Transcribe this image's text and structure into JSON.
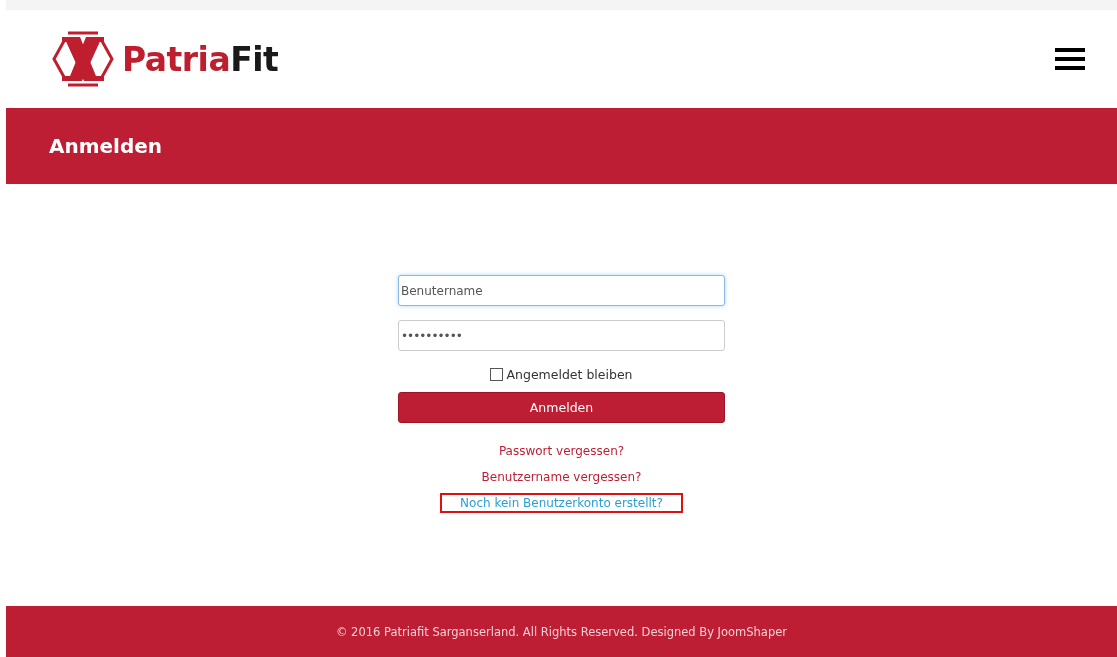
{
  "header": {
    "logo": {
      "primary": "Patria",
      "secondary": "Fit"
    }
  },
  "page_title": "Anmelden",
  "form": {
    "username": {
      "value": "Benutername",
      "focused": true
    },
    "password": {
      "value": "••••••••••",
      "focused": false
    },
    "remember": {
      "label": "Angemeldet bleiben",
      "checked": false
    },
    "submit": "Anmelden",
    "links": [
      {
        "label": "Passwort vergessen?",
        "kind": "accent",
        "highlighted": false
      },
      {
        "label": "Benutzername vergessen?",
        "kind": "accent",
        "highlighted": false
      },
      {
        "label": "Noch kein Benutzerkonto erstellt?",
        "kind": "info",
        "highlighted": true
      }
    ]
  },
  "footer": "© 2016 Patriafit Sarganserland. All Rights Reserved. Designed By JoomShaper"
}
